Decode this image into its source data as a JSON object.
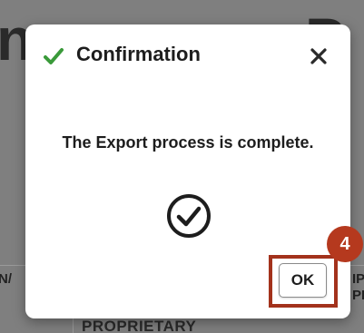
{
  "background": {
    "heading_partial": "n",
    "heading_tail": "P",
    "table_cell_left": "N/",
    "table_cell_right_line1": "IP",
    "table_cell_right_line2": "PR",
    "proprietary_text": "PROPRIETARY"
  },
  "dialog": {
    "title": "Confirmation",
    "title_icon": "check-icon",
    "close_icon": "close-icon",
    "close_label": "×",
    "message": "The Export process is complete.",
    "status_icon": "circle-check-icon",
    "ok_label": "OK"
  },
  "annotation": {
    "step_number": "4",
    "highlight_color": "#a3321c",
    "badge_color": "#b5391e"
  },
  "colors": {
    "overlay": "#7f7f7f",
    "check_green": "#3a9a3a",
    "text_dark": "#1d1d1d"
  }
}
